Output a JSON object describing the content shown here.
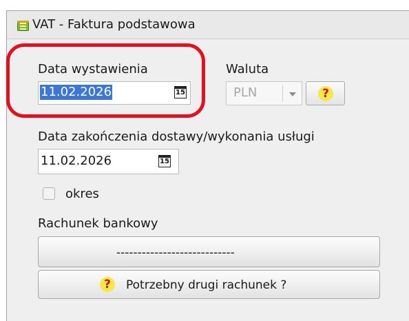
{
  "window": {
    "title": "VAT - Faktura podstawowa",
    "icon": "document-icon"
  },
  "issue_date": {
    "label": "Data wystawienia",
    "value": "11.02.2026",
    "calendar_icon_text": "15"
  },
  "currency": {
    "label": "Waluta",
    "value": "PLN",
    "help_icon": "?"
  },
  "delivery_date": {
    "label": "Data zakończenia dostawy/wykonania usługi",
    "value": "11.02.2026",
    "calendar_icon_text": "15"
  },
  "period": {
    "label": "okres",
    "checked": false
  },
  "bank_account": {
    "label": "Rachunek bankowy",
    "button_label": "----------------------------"
  },
  "second_account": {
    "button_label": "Potrzebny drugi rachunek ?",
    "help_icon": "?"
  },
  "colors": {
    "highlight": "#e3111f",
    "selection": "#3d77d6",
    "help_icon_bg": "#f7e84a",
    "help_icon_fg": "#d01010"
  }
}
